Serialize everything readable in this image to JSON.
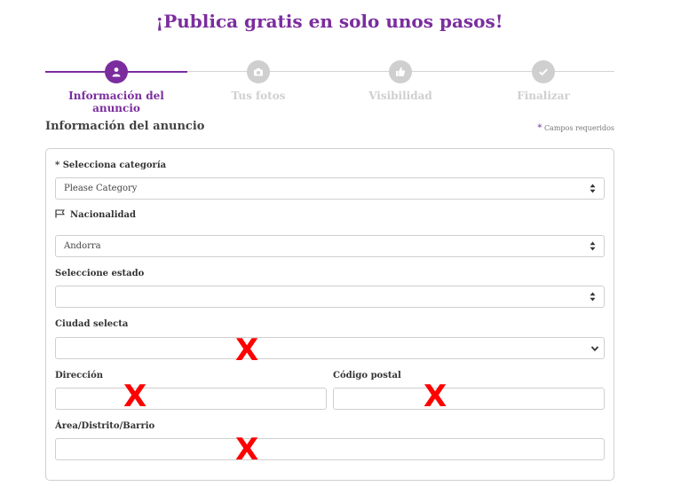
{
  "page_title": "¡Publica gratis en solo unos pasos!",
  "stepper": {
    "steps": [
      {
        "label": "Información del anuncio",
        "icon": "user-icon",
        "active": true
      },
      {
        "label": "Tus fotos",
        "icon": "camera-icon",
        "active": false
      },
      {
        "label": "Visibilidad",
        "icon": "thumbs-up-icon",
        "active": false
      },
      {
        "label": "Finalizar",
        "icon": "check-icon",
        "active": false
      }
    ]
  },
  "section": {
    "title": "Información del anuncio",
    "required_star": "*",
    "required_note": "Campos requeridos"
  },
  "form": {
    "category": {
      "label": "* Selecciona categoría",
      "value": "Please Category"
    },
    "nationality": {
      "label": "Nacionalidad",
      "icon": "flag-icon",
      "value": "Andorra"
    },
    "state": {
      "label": "Seleccione estado",
      "value": ""
    },
    "city": {
      "label": "Ciudad selecta",
      "value": ""
    },
    "address": {
      "label": "Dirección",
      "value": ""
    },
    "postal_code": {
      "label": "Código postal",
      "value": ""
    },
    "area": {
      "label": "Área/Distrito/Barrio",
      "value": ""
    }
  },
  "annotations": {
    "x_mark": "X"
  },
  "colors": {
    "accent": "#7b2d9e",
    "inactive": "#cfcfcf",
    "annotation": "#ff0000"
  }
}
